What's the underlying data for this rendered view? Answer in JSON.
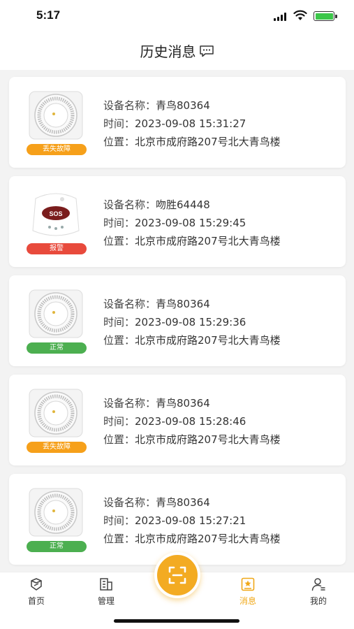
{
  "status_bar": {
    "time": "5:17"
  },
  "header": {
    "title": "历史消息"
  },
  "messages": [
    {
      "name_label": "设备名称：",
      "device_name": "青鸟80364",
      "time_label": "时间：",
      "time": "2023-09-08 15:31:27",
      "loc_label": "位置：",
      "location": "北京市成府路207号北大青鸟楼",
      "status": "丢失故障",
      "status_color": "#f6a01a",
      "device_type": "smoke-detector"
    },
    {
      "name_label": "设备名称：",
      "device_name": "吻胜64448",
      "time_label": "时间：",
      "time": "2023-09-08 15:29:45",
      "loc_label": "位置：",
      "location": "北京市成府路207号北大青鸟楼",
      "status": "报警",
      "status_color": "#e84a3c",
      "device_type": "sos-button"
    },
    {
      "name_label": "设备名称：",
      "device_name": "青鸟80364",
      "time_label": "时间：",
      "time": "2023-09-08 15:29:36",
      "loc_label": "位置：",
      "location": "北京市成府路207号北大青鸟楼",
      "status": "正常",
      "status_color": "#4caf50",
      "device_type": "smoke-detector"
    },
    {
      "name_label": "设备名称：",
      "device_name": "青鸟80364",
      "time_label": "时间：",
      "time": "2023-09-08 15:28:46",
      "loc_label": "位置：",
      "location": "北京市成府路207号北大青鸟楼",
      "status": "丢失故障",
      "status_color": "#f6a01a",
      "device_type": "smoke-detector"
    },
    {
      "name_label": "设备名称：",
      "device_name": "青鸟80364",
      "time_label": "时间：",
      "time": "2023-09-08 15:27:21",
      "loc_label": "位置：",
      "location": "北京市成府路207号北大青鸟楼",
      "status": "正常",
      "status_color": "#4caf50",
      "device_type": "smoke-detector"
    }
  ],
  "tabbar": {
    "home": "首页",
    "manage": "管理",
    "messages": "消息",
    "mine": "我的",
    "active": "messages",
    "accent_color": "#f0a818"
  }
}
